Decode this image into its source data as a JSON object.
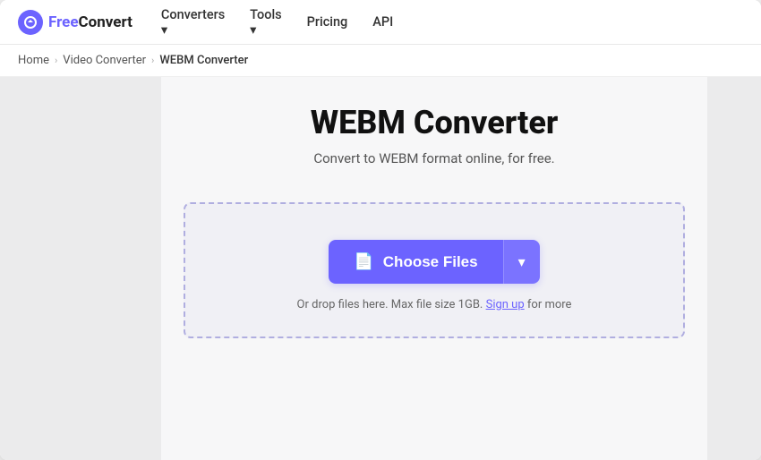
{
  "nav": {
    "logo_free": "Free",
    "logo_convert": "Convert",
    "links": [
      {
        "label": "Converters",
        "has_dropdown": true
      },
      {
        "label": "Tools",
        "has_dropdown": true
      },
      {
        "label": "Pricing",
        "has_dropdown": false
      },
      {
        "label": "API",
        "has_dropdown": false
      }
    ]
  },
  "breadcrumb": {
    "items": [
      {
        "label": "Home",
        "is_link": true
      },
      {
        "label": "Video Converter",
        "is_link": true
      },
      {
        "label": "WEBM Converter",
        "is_link": false
      }
    ]
  },
  "page": {
    "title": "WEBM Converter",
    "subtitle": "Convert to WEBM format online, for free.",
    "dropzone": {
      "choose_files_label": "Choose Files",
      "drop_hint": "Or drop files here. Max file size 1GB.",
      "signup_label": "Sign up",
      "drop_hint_suffix": " for more"
    }
  }
}
